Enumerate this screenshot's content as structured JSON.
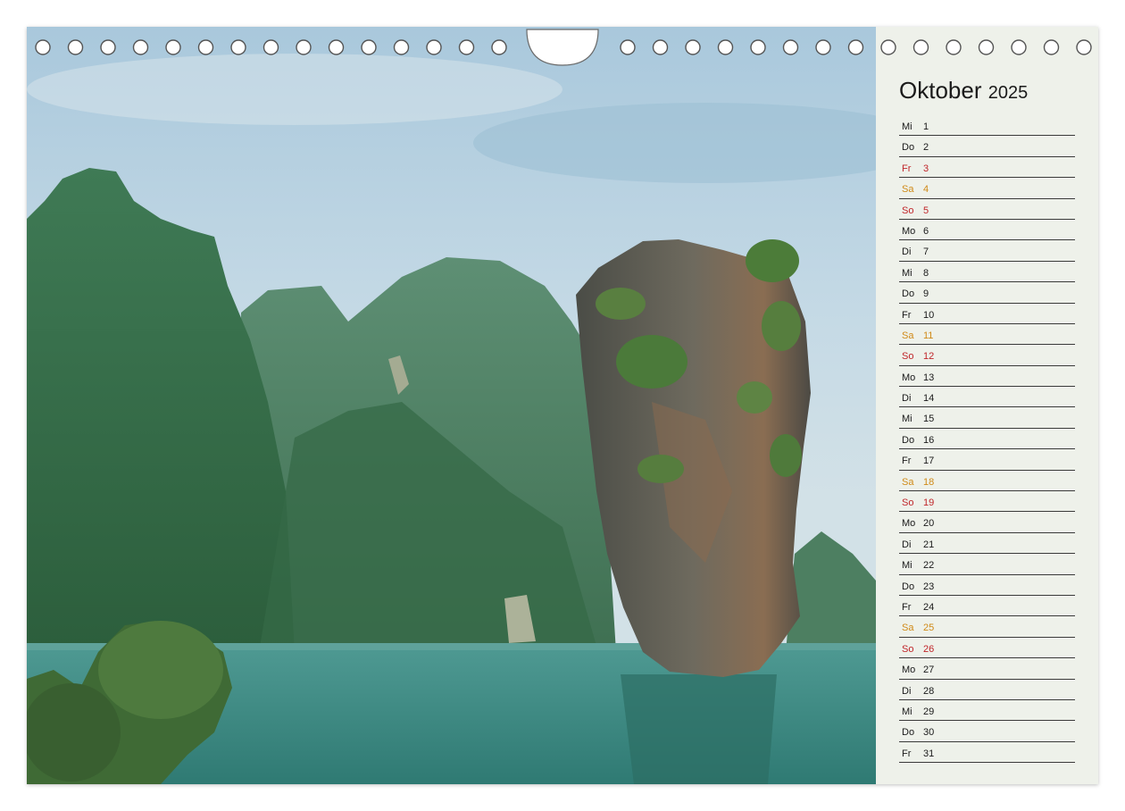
{
  "calendar": {
    "month": "Oktober",
    "year": "2025",
    "colors": {
      "saturday": "#d08a18",
      "sunday": "#c0262a",
      "weekday": "#1a1a1a",
      "sidebar_bg": "#eef1ea"
    },
    "days": [
      {
        "name": "Mi",
        "num": "1",
        "type": "weekday"
      },
      {
        "name": "Do",
        "num": "2",
        "type": "weekday"
      },
      {
        "name": "Fr",
        "num": "3",
        "type": "holiday"
      },
      {
        "name": "Sa",
        "num": "4",
        "type": "sat"
      },
      {
        "name": "So",
        "num": "5",
        "type": "sun"
      },
      {
        "name": "Mo",
        "num": "6",
        "type": "weekday"
      },
      {
        "name": "Di",
        "num": "7",
        "type": "weekday"
      },
      {
        "name": "Mi",
        "num": "8",
        "type": "weekday"
      },
      {
        "name": "Do",
        "num": "9",
        "type": "weekday"
      },
      {
        "name": "Fr",
        "num": "10",
        "type": "weekday"
      },
      {
        "name": "Sa",
        "num": "11",
        "type": "sat"
      },
      {
        "name": "So",
        "num": "12",
        "type": "sun"
      },
      {
        "name": "Mo",
        "num": "13",
        "type": "weekday"
      },
      {
        "name": "Di",
        "num": "14",
        "type": "weekday"
      },
      {
        "name": "Mi",
        "num": "15",
        "type": "weekday"
      },
      {
        "name": "Do",
        "num": "16",
        "type": "weekday"
      },
      {
        "name": "Fr",
        "num": "17",
        "type": "weekday"
      },
      {
        "name": "Sa",
        "num": "18",
        "type": "sat"
      },
      {
        "name": "So",
        "num": "19",
        "type": "sun"
      },
      {
        "name": "Mo",
        "num": "20",
        "type": "weekday"
      },
      {
        "name": "Di",
        "num": "21",
        "type": "weekday"
      },
      {
        "name": "Mi",
        "num": "22",
        "type": "weekday"
      },
      {
        "name": "Do",
        "num": "23",
        "type": "weekday"
      },
      {
        "name": "Fr",
        "num": "24",
        "type": "weekday"
      },
      {
        "name": "Sa",
        "num": "25",
        "type": "sat"
      },
      {
        "name": "So",
        "num": "26",
        "type": "sun"
      },
      {
        "name": "Mo",
        "num": "27",
        "type": "weekday"
      },
      {
        "name": "Di",
        "num": "28",
        "type": "weekday"
      },
      {
        "name": "Mi",
        "num": "29",
        "type": "weekday"
      },
      {
        "name": "Do",
        "num": "30",
        "type": "weekday"
      },
      {
        "name": "Fr",
        "num": "31",
        "type": "weekday"
      }
    ]
  }
}
